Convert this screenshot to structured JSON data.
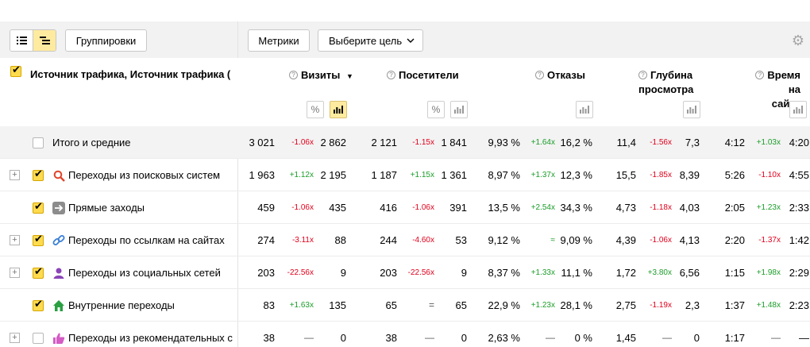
{
  "toolbar": {
    "groupings_label": "Группировки",
    "metrics_label": "Метрики",
    "goal_label": "Выберите цель"
  },
  "header": {
    "dimension_title": "Источник трафика, Источник трафика (",
    "columns": [
      "Визиты",
      "Посетители",
      "Отказы",
      "Глубина просмотра",
      "Время на сайте"
    ],
    "col_visits": "Визиты",
    "col_visitors": "Посетители",
    "col_bounces": "Отказы",
    "col_depth_1": "Глубина",
    "col_depth_2": "просмотра",
    "col_time_1": "Время на",
    "col_time_2": "сайте",
    "sort_arrow": "▼",
    "percent_symbol": "%"
  },
  "rows": [
    {
      "label": "Итого и средние",
      "icon": "none",
      "checked": false,
      "expandable": false,
      "v": [
        "3 021",
        "-1.06x",
        "2 862",
        "2 121",
        "-1.15x",
        "1 841",
        "9,93 %",
        "+1.64x",
        "16,2 %",
        "11,4",
        "-1.56x",
        "7,3",
        "4:12",
        "+1.03x",
        "4:20"
      ]
    },
    {
      "label": "Переходы из поисковых систем",
      "icon": "search-icon",
      "checked": true,
      "expandable": true,
      "v": [
        "1 963",
        "+1.12x",
        "2 195",
        "1 187",
        "+1.15x",
        "1 361",
        "8,97 %",
        "+1.37x",
        "12,3 %",
        "15,5",
        "-1.85x",
        "8,39",
        "5:26",
        "-1.10x",
        "4:55"
      ]
    },
    {
      "label": "Прямые заходы",
      "icon": "arrow-right-icon",
      "checked": true,
      "expandable": false,
      "v": [
        "459",
        "-1.06x",
        "435",
        "416",
        "-1.06x",
        "391",
        "13,5 %",
        "+2.54x",
        "34,3 %",
        "4,73",
        "-1.18x",
        "4,03",
        "2:05",
        "+1.23x",
        "2:33"
      ]
    },
    {
      "label": "Переходы по ссылкам на сайтах",
      "icon": "link-icon",
      "checked": true,
      "expandable": true,
      "v": [
        "274",
        "-3.11x",
        "88",
        "244",
        "-4.60x",
        "53",
        "9,12 %",
        "≈",
        "9,09 %",
        "4,39",
        "-1.06x",
        "4,13",
        "2:20",
        "-1.37x",
        "1:42"
      ]
    },
    {
      "label": "Переходы из социальных сетей",
      "icon": "user-icon",
      "checked": true,
      "expandable": true,
      "v": [
        "203",
        "-22.56x",
        "9",
        "203",
        "-22.56x",
        "9",
        "8,37 %",
        "+1.33x",
        "11,1 %",
        "1,72",
        "+3.80x",
        "6,56",
        "1:15",
        "+1.98x",
        "2:29"
      ]
    },
    {
      "label": "Внутренние переходы",
      "icon": "home-icon",
      "checked": true,
      "expandable": false,
      "v": [
        "83",
        "+1.63x",
        "135",
        "65",
        "=",
        "65",
        "22,9 %",
        "+1.23x",
        "28,1 %",
        "2,75",
        "-1.19x",
        "2,3",
        "1:37",
        "+1.48x",
        "2:23"
      ]
    },
    {
      "label": "Переходы из рекомендательных с",
      "icon": "thumbs-up-icon",
      "checked": false,
      "expandable": true,
      "v": [
        "38",
        "—",
        "0",
        "38",
        "—",
        "0",
        "2,63 %",
        "—",
        "0 %",
        "1,45",
        "—",
        "0",
        "1:17",
        "—",
        "—"
      ]
    }
  ],
  "colors": {
    "accent_yellow": "#ffdb4d",
    "active_toggle": "#ffeba0",
    "negative": "#e0001b",
    "positive": "#1c9d2a",
    "toolbar_bg": "#f2f2f2"
  }
}
